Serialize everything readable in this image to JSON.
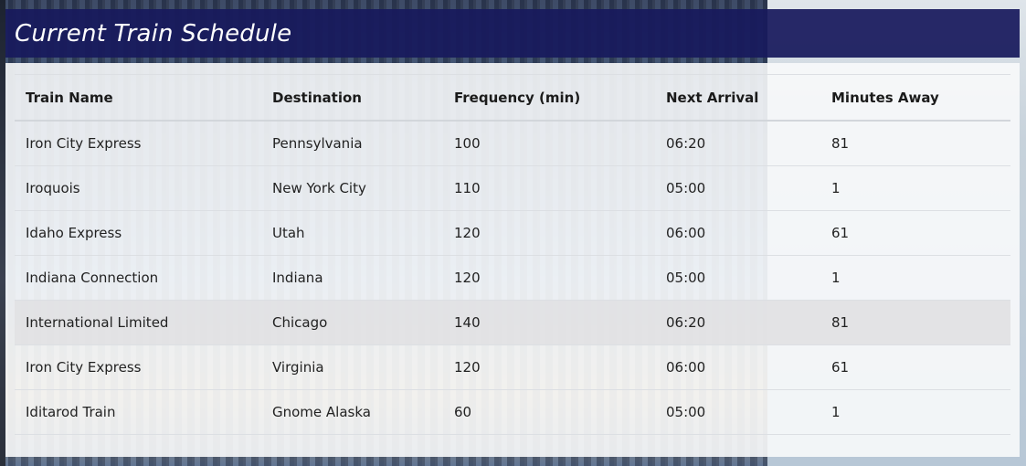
{
  "page": {
    "title": "Current Train Schedule"
  },
  "table": {
    "headers": [
      "Train Name",
      "Destination",
      "Frequency (min)",
      "Next Arrival",
      "Minutes Away"
    ],
    "rows": [
      [
        "Iron City Express",
        "Pennsylvania",
        "100",
        "06:20",
        "81"
      ],
      [
        "Iroquois",
        "New York City",
        "110",
        "05:00",
        "1"
      ],
      [
        "Idaho Express",
        "Utah",
        "120",
        "06:00",
        "61"
      ],
      [
        "Indiana Connection",
        "Indiana",
        "120",
        "05:00",
        "1"
      ],
      [
        "International Limited",
        "Chicago",
        "140",
        "06:20",
        "81"
      ],
      [
        "Iron City Express",
        "Virginia",
        "120",
        "06:00",
        "61"
      ],
      [
        "Iditarod Train",
        "Gnome Alaska",
        "60",
        "05:00",
        "1"
      ]
    ],
    "highlighted_row_index": 4
  },
  "colors": {
    "title_bar": "#181a5c",
    "panel": "#f8f9fb",
    "highlight_row": "#e1e2e4"
  }
}
